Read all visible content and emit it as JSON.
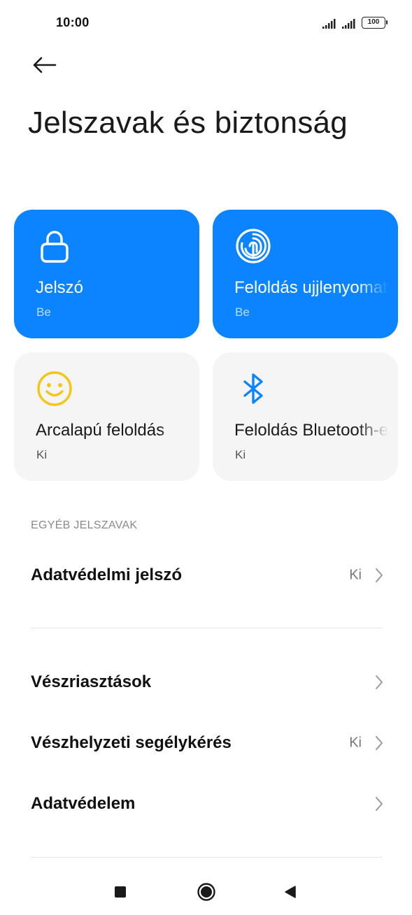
{
  "status_bar": {
    "time": "10:00",
    "battery": "100",
    "icons": [
      "signal-icon",
      "signal-icon",
      "battery-icon"
    ]
  },
  "header": {
    "back_icon": "arrow-left-icon",
    "title": "Jelszavak és biztonság"
  },
  "tiles": [
    {
      "title": "Jelszó",
      "status": "Be",
      "icon": "lock-icon",
      "active": true,
      "color": "#0d84ff"
    },
    {
      "title": "Feloldás ujjlenyomattal",
      "status": "Be",
      "icon": "fingerprint-icon",
      "active": true,
      "color": "#0d84ff"
    },
    {
      "title": "Arcalapú feloldás",
      "status": "Ki",
      "icon": "smiley-face-icon",
      "active": false,
      "color": "#f5c518"
    },
    {
      "title": "Feloldás Bluetooth-eszközzel",
      "status": "Ki",
      "icon": "bluetooth-icon",
      "active": false,
      "color": "#0d84ff"
    }
  ],
  "sections": {
    "other_passwords": "EGYÉB JELSZAVAK"
  },
  "rows": [
    {
      "label": "Adatvédelmi jelszó",
      "value": "Ki"
    },
    {
      "label": "Vészriasztások",
      "value": ""
    },
    {
      "label": "Vészhelyzeti segélykérés",
      "value": "Ki"
    },
    {
      "label": "Adatvédelem",
      "value": ""
    }
  ],
  "nav_bar": {
    "icons": [
      "recents-square-icon",
      "home-circle-icon",
      "back-triangle-icon"
    ]
  }
}
